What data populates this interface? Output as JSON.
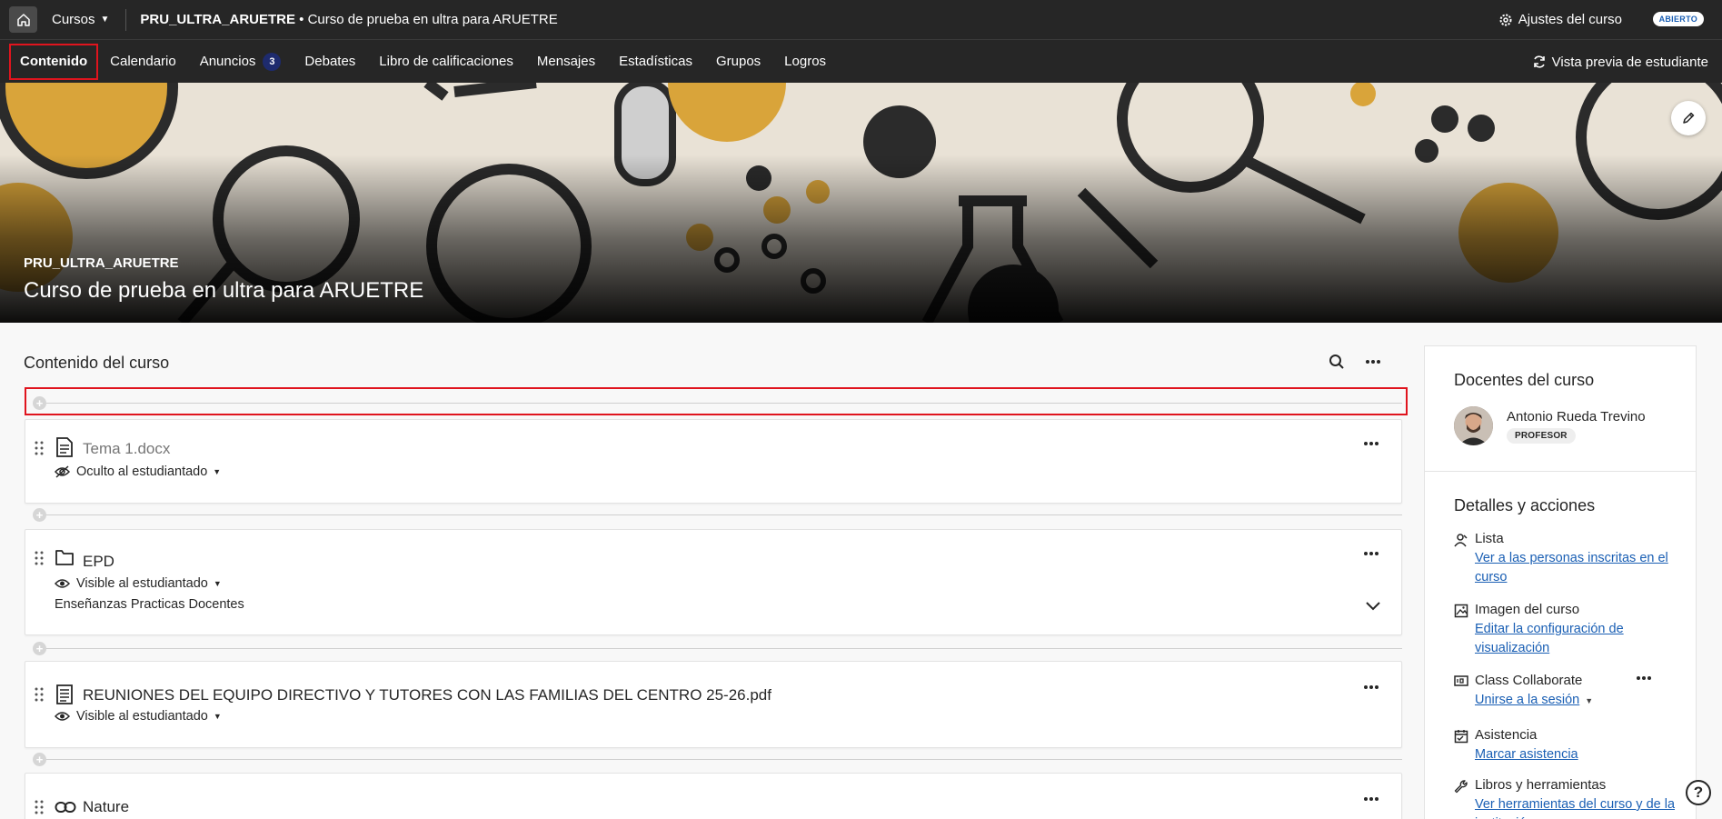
{
  "topbar": {
    "courses_label": "Cursos",
    "course_code": "PRU_ULTRA_ARUETRE",
    "course_name": " • Curso de prueba en ultra para ARUETRE",
    "settings_label": "Ajustes del curso",
    "status_badge": "ABIERTO"
  },
  "nav": {
    "items": [
      {
        "label": "Contenido"
      },
      {
        "label": "Calendario"
      },
      {
        "label": "Anuncios",
        "badge": "3"
      },
      {
        "label": "Debates"
      },
      {
        "label": "Libro de calificaciones"
      },
      {
        "label": "Mensajes"
      },
      {
        "label": "Estadísticas"
      },
      {
        "label": "Grupos"
      },
      {
        "label": "Logros"
      }
    ],
    "preview_label": "Vista previa de estudiante"
  },
  "banner": {
    "code": "PRU_ULTRA_ARUETRE",
    "title": "Curso de prueba en ultra para ARUETRE"
  },
  "content": {
    "heading": "Contenido del curso",
    "items": [
      {
        "title": "Tema 1.docx",
        "visibility": "Oculto al estudiantado",
        "icon": "document-icon"
      },
      {
        "title": "EPD",
        "visibility": "Visible al estudiantado",
        "description": "Enseñanzas Practicas Docentes",
        "icon": "folder-icon"
      },
      {
        "title": "REUNIONES DEL EQUIPO DIRECTIVO Y TUTORES CON LAS FAMILIAS DEL CENTRO 25-26.pdf",
        "visibility": "Visible al estudiantado",
        "icon": "document-icon"
      },
      {
        "title": "Nature",
        "icon": "link-icon"
      }
    ]
  },
  "sidebar": {
    "teachers_heading": "Docentes del curso",
    "teacher_name": "Antonio Rueda Trevino",
    "teacher_role": "PROFESOR",
    "details_heading": "Detalles y acciones",
    "actions": [
      {
        "title": "Lista",
        "link": "Ver a las personas inscritas en el curso",
        "icon": "roster-icon"
      },
      {
        "title": "Imagen del curso",
        "link": "Editar la configuración de visualización",
        "icon": "image-icon"
      },
      {
        "title": "Class Collaborate",
        "link": "Unirse a la sesión",
        "icon": "collaborate-icon"
      },
      {
        "title": "Asistencia",
        "link": "Marcar asistencia",
        "icon": "attendance-icon"
      },
      {
        "title": "Libros y herramientas",
        "link": "Ver herramientas del curso y de la institución",
        "icon": "wrench-icon"
      }
    ]
  }
}
